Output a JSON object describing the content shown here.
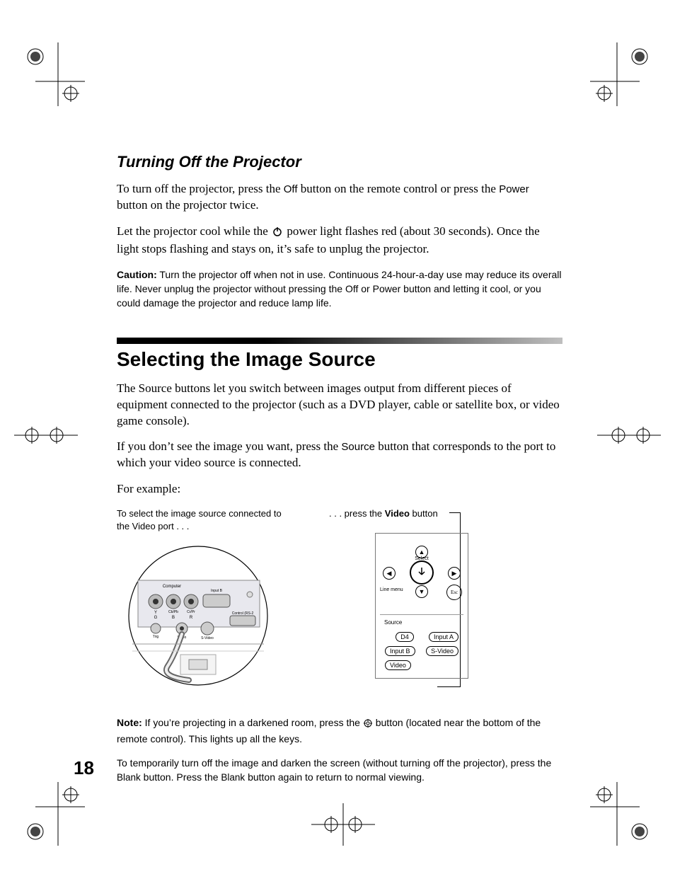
{
  "page_number": "18",
  "subsection": {
    "title": "Turning Off the Projector",
    "p1_a": "To turn off the projector, press the ",
    "p1_off": "Off",
    "p1_b": " button on the remote control or press the ",
    "p1_power": "Power",
    "p1_c": " button on the projector twice.",
    "p2_a": "Let the projector cool while the ",
    "p2_b": " power light flashes red (about 30 seconds). Once the light stops flashing and stays on, it’s safe to unplug the projector.",
    "caution_label": "Caution:",
    "caution_text": " Turn the projector off when not in use. Continuous 24-hour-a-day use may reduce its overall life. Never unplug the projector without pressing the Off or Power button and letting it cool, or you could damage the projector and reduce lamp life."
  },
  "section": {
    "title": "Selecting the Image Source",
    "p1": "The Source buttons let you switch between images output from different pieces of equipment connected to the projector (such as a DVD player, cable or satellite box, or video game console).",
    "p2_a": "If you don’t see the image you want, press the ",
    "p2_source": "Source",
    "p2_b": " button that corresponds to the port to which your video source is connected.",
    "p3": "For example:",
    "callout_left": "To select the image source connected to the Video port . . .",
    "callout_right_a": ". . . press the ",
    "callout_right_video": "Video",
    "callout_right_b": " button",
    "note_label": "Note:",
    "note_a": " If you’re projecting in a darkened room, press the ",
    "note_b": " button (located near the bottom of the remote control). This lights up all the keys.",
    "tip_a": "To temporarily turn off the image and darken the screen (without turning off the projector), press the ",
    "tip_blank": "Blank",
    "tip_b": " button. Press the ",
    "tip_c": " button again to return to normal viewing."
  },
  "remote": {
    "select_label": "Select",
    "line_menu": "Line menu",
    "esc": "Esc",
    "source_label": "Source",
    "d4": "D4",
    "input_a": "Input A",
    "input_b": "Input B",
    "s_video": "S-Video",
    "video": "Video"
  },
  "ports": {
    "computer": "Computer",
    "y": "Y",
    "cb_pb": "Cb/Pb",
    "cr_pr": "Cr/Pr",
    "g": "G",
    "b": "B",
    "r": "R",
    "input_b": "Input B",
    "control": "Control (RS-2…",
    "trig": "Trig",
    "video": "Video",
    "s_video": "S-Video"
  }
}
